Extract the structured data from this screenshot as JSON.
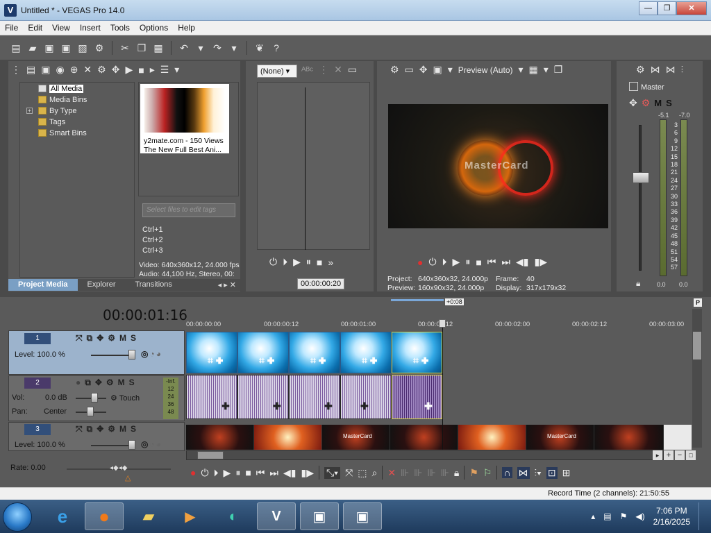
{
  "window": {
    "title": "Untitled * - VEGAS Pro 14.0",
    "app_icon": "V"
  },
  "menu": [
    "File",
    "Edit",
    "View",
    "Insert",
    "Tools",
    "Options",
    "Help"
  ],
  "media_tree": {
    "items": [
      {
        "label": "All Media",
        "selected": true
      },
      {
        "label": "Media Bins"
      },
      {
        "label": "By Type",
        "expandable": true
      },
      {
        "label": "Tags"
      },
      {
        "label": "Smart Bins"
      }
    ]
  },
  "media_thumb": {
    "caption1": "y2mate.com - 150 Views",
    "caption2": "The New Full Best Ani..."
  },
  "tag_input": {
    "placeholder": "Select files to edit tags"
  },
  "shortcuts": [
    "Ctrl+1",
    "Ctrl+2",
    "Ctrl+3"
  ],
  "media_info": {
    "video": "Video: 640x360x12, 24.000 fps",
    "audio": "Audio: 44,100 Hz, Stereo, 00:"
  },
  "tabs": [
    "Project Media",
    "Explorer",
    "Transitions"
  ],
  "trimmer": {
    "dropdown": "(None)",
    "timecode": "00:00:00:20"
  },
  "preview": {
    "mode": "Preview (Auto)",
    "project_label": "Project:",
    "project_value": "640x360x32, 24.000p",
    "preview_label": "Preview:",
    "preview_value": "160x90x32, 24.000p",
    "frame_label": "Frame:",
    "frame_value": "40",
    "display_label": "Display:",
    "display_value": "317x179x32",
    "overlay_text": "MasterCard"
  },
  "master": {
    "label": "Master",
    "left_peak": "-5.1",
    "right_peak": "-7.0",
    "scale": [
      "3",
      "6",
      "9",
      "12",
      "15",
      "18",
      "21",
      "24",
      "27",
      "30",
      "33",
      "36",
      "39",
      "42",
      "45",
      "48",
      "51",
      "54",
      "57"
    ],
    "bottom_left": "0.0",
    "bottom_right": "0.0"
  },
  "timeline": {
    "timecode": "00:00:01:16",
    "loop_label": "+0:08",
    "ruler": [
      "00:00:00:00",
      "00:00:00:12",
      "00:00:01:00",
      "00:00:01:12",
      "00:00:02:00",
      "00:00:02:12",
      "00:00:03:00"
    ],
    "tracks": [
      {
        "num": "1",
        "level": "Level: 100.0 %"
      },
      {
        "num": "2",
        "vol_label": "Vol:",
        "vol_value": "0.0 dB",
        "touch": "Touch",
        "pan_label": "Pan:",
        "pan_value": "Center",
        "meter_label": "-Inf.",
        "meter_vals": [
          "12",
          "24",
          "36",
          "48"
        ]
      },
      {
        "num": "3",
        "level": "Level: 100.0 %"
      }
    ],
    "rate": "Rate: 0.00",
    "mc_label": "MasterCard"
  },
  "status": {
    "record_time": "Record Time (2 channels): 21:50:55"
  },
  "taskbar": {
    "time": "7:06 PM",
    "date": "2/16/2025"
  },
  "colors": {
    "accent": "#7a9fc4",
    "panel": "#595959",
    "clip_video": "#33a9e6",
    "clip_audio": "#7a5a9e"
  }
}
